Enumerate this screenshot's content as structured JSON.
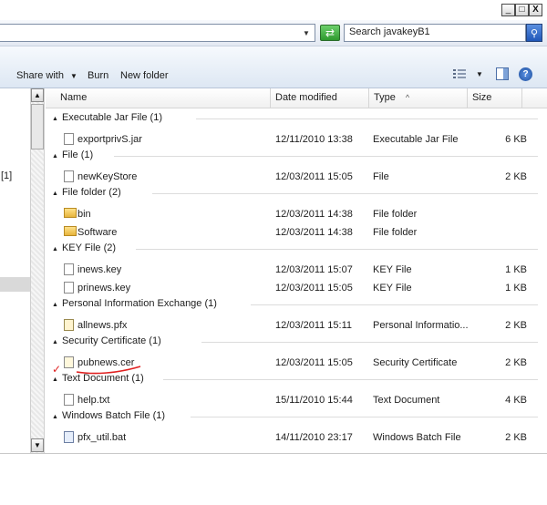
{
  "window": {
    "minimize": "_",
    "maximize": "□",
    "close": "X"
  },
  "search": {
    "placeholder": "Search javakeyB1"
  },
  "toolbar": {
    "share_with": "Share with",
    "share_arrow": "▼",
    "burn": "Burn",
    "new_folder": "New folder",
    "view_arrow": "▼"
  },
  "nav": {
    "partial_count": "[1]"
  },
  "columns": {
    "name": "Name",
    "date": "Date modified",
    "type": "Type",
    "type_sort": "^",
    "size": "Size"
  },
  "groups": [
    {
      "label": "Executable Jar File (1)",
      "files": [
        {
          "name": "exportprivS.jar",
          "date": "12/11/2010 13:38",
          "type": "Executable Jar File",
          "size": "6 KB",
          "icon": "jar-file-icon"
        }
      ]
    },
    {
      "label": "File (1)",
      "files": [
        {
          "name": "newKeyStore",
          "date": "12/03/2011 15:05",
          "type": "File",
          "size": "2 KB",
          "icon": "file-icon"
        }
      ]
    },
    {
      "label": "File folder (2)",
      "files": [
        {
          "name": "bin",
          "date": "12/03/2011 14:38",
          "type": "File folder",
          "size": "",
          "icon": "folder-icon"
        },
        {
          "name": "Software",
          "date": "12/03/2011 14:38",
          "type": "File folder",
          "size": "",
          "icon": "folder-icon"
        }
      ]
    },
    {
      "label": "KEY File (2)",
      "files": [
        {
          "name": "inews.key",
          "date": "12/03/2011 15:07",
          "type": "KEY File",
          "size": "1 KB",
          "icon": "key-file-icon"
        },
        {
          "name": "prinews.key",
          "date": "12/03/2011 15:05",
          "type": "KEY File",
          "size": "1 KB",
          "icon": "key-file-icon"
        }
      ]
    },
    {
      "label": "Personal Information Exchange (1)",
      "files": [
        {
          "name": "allnews.pfx",
          "date": "12/03/2011 15:11",
          "type": "Personal Informatio...",
          "size": "2 KB",
          "icon": "pfx-file-icon"
        }
      ]
    },
    {
      "label": "Security Certificate (1)",
      "files": [
        {
          "name": "pubnews.cer",
          "date": "12/03/2011 15:05",
          "type": "Security Certificate",
          "size": "2 KB",
          "icon": "certificate-icon"
        }
      ]
    },
    {
      "label": "Text Document (1)",
      "files": [
        {
          "name": "help.txt",
          "date": "15/11/2010 15:44",
          "type": "Text Document",
          "size": "4 KB",
          "icon": "text-file-icon"
        }
      ]
    },
    {
      "label": "Windows Batch File (1)",
      "files": [
        {
          "name": "pfx_util.bat",
          "date": "14/11/2010 23:17",
          "type": "Windows Batch File",
          "size": "2 KB",
          "icon": "batch-file-icon"
        }
      ]
    }
  ],
  "annotation": {
    "mark": "✓",
    "color": "#e02020"
  }
}
